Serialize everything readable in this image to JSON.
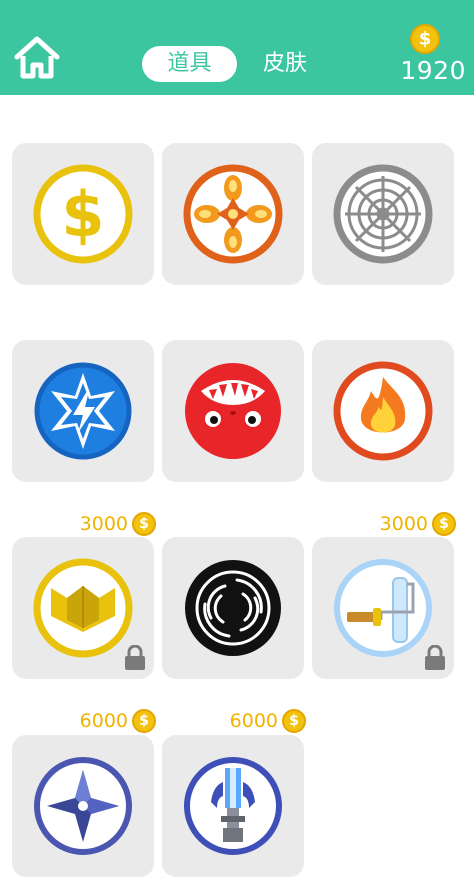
{
  "header": {
    "home_icon": "home-icon",
    "tabs": [
      {
        "label": "道具",
        "active": true
      },
      {
        "label": "皮肤",
        "active": false
      }
    ],
    "coin_icon": "coin-icon",
    "coins": "1920"
  },
  "colors": {
    "header_bg": "#3cc6a0",
    "card_bg": "#eaeaea",
    "price_text": "#f0b400",
    "coin": "#f3c20d"
  },
  "currency_symbol": "$",
  "items": [
    {
      "icon": "dollar-coin-icon",
      "price": null,
      "locked": false
    },
    {
      "icon": "fire-cross-icon",
      "price": null,
      "locked": false
    },
    {
      "icon": "spider-web-icon",
      "price": null,
      "locked": false
    },
    {
      "icon": "lightning-star-icon",
      "price": null,
      "locked": false
    },
    {
      "icon": "red-monster-icon",
      "price": null,
      "locked": false
    },
    {
      "icon": "flame-icon",
      "price": null,
      "locked": false
    },
    {
      "icon": "golden-shield-icon",
      "price": "3000",
      "locked": true
    },
    {
      "icon": "black-hole-icon",
      "price": null,
      "locked": false
    },
    {
      "icon": "paint-roller-icon",
      "price": "3000",
      "locked": true
    },
    {
      "icon": "shuriken-icon",
      "price": "6000",
      "locked": false
    },
    {
      "icon": "laser-claw-icon",
      "price": "6000",
      "locked": false
    }
  ]
}
